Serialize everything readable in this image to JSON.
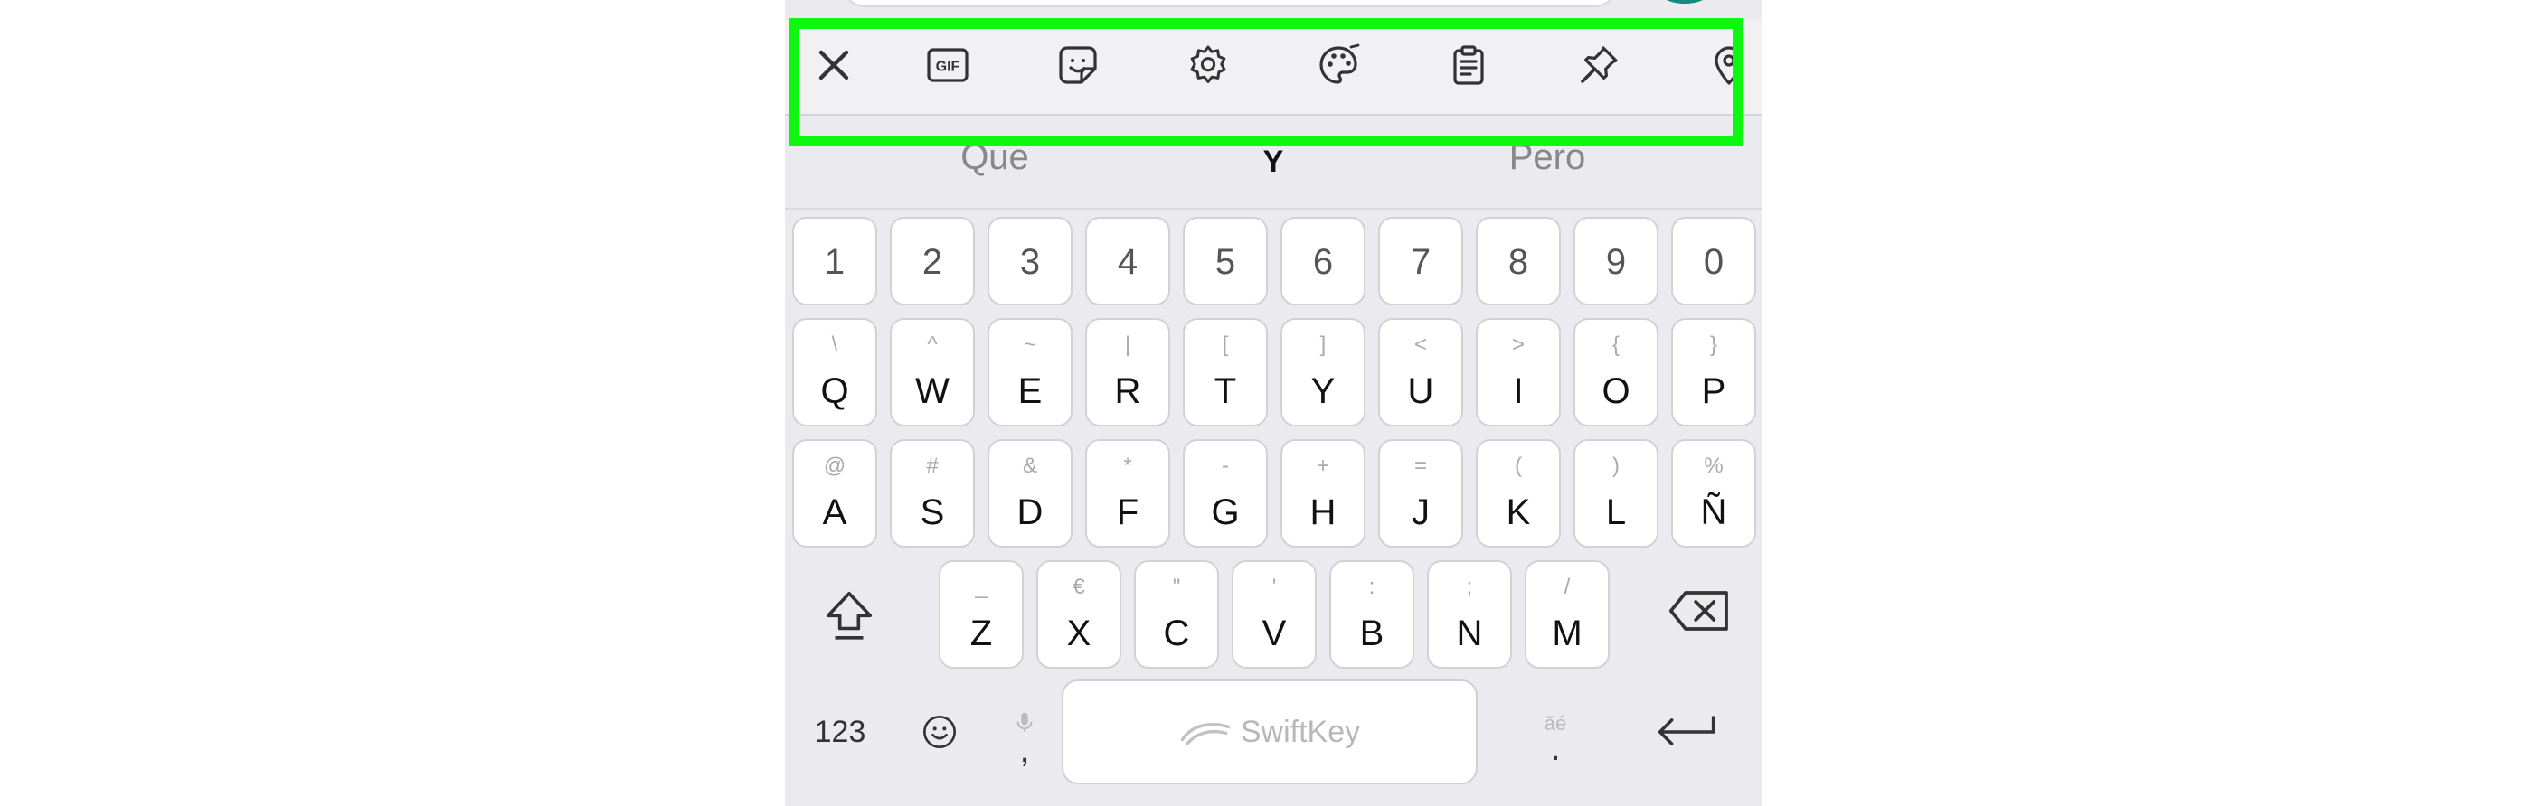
{
  "toolbar": {
    "tools": [
      {
        "icon": "close-icon"
      },
      {
        "icon": "gif-icon",
        "label": "GIF"
      },
      {
        "icon": "sticker-icon"
      },
      {
        "icon": "settings-icon"
      },
      {
        "icon": "palette-icon"
      },
      {
        "icon": "clipboard-icon"
      },
      {
        "icon": "pin-icon"
      },
      {
        "icon": "location-icon"
      }
    ]
  },
  "suggestions": {
    "left": "Que",
    "center": "Y",
    "right": "Pero"
  },
  "keyboard": {
    "number_row": [
      "1",
      "2",
      "3",
      "4",
      "5",
      "6",
      "7",
      "8",
      "9",
      "0"
    ],
    "row1": [
      {
        "main": "Q",
        "hint": "\\"
      },
      {
        "main": "W",
        "hint": "^"
      },
      {
        "main": "E",
        "hint": "~"
      },
      {
        "main": "R",
        "hint": "|"
      },
      {
        "main": "T",
        "hint": "["
      },
      {
        "main": "Y",
        "hint": "]"
      },
      {
        "main": "U",
        "hint": "<"
      },
      {
        "main": "I",
        "hint": ">"
      },
      {
        "main": "O",
        "hint": "{"
      },
      {
        "main": "P",
        "hint": "}"
      }
    ],
    "row2": [
      {
        "main": "A",
        "hint": "@"
      },
      {
        "main": "S",
        "hint": "#"
      },
      {
        "main": "D",
        "hint": "&"
      },
      {
        "main": "F",
        "hint": "*"
      },
      {
        "main": "G",
        "hint": "-"
      },
      {
        "main": "H",
        "hint": "+"
      },
      {
        "main": "J",
        "hint": "="
      },
      {
        "main": "K",
        "hint": "("
      },
      {
        "main": "L",
        "hint": ")"
      },
      {
        "main": "Ñ",
        "hint": "%"
      }
    ],
    "row3": [
      {
        "main": "Z",
        "hint": "_"
      },
      {
        "main": "X",
        "hint": "€"
      },
      {
        "main": "C",
        "hint": "\""
      },
      {
        "main": "V",
        "hint": "'"
      },
      {
        "main": "B",
        "hint": ":"
      },
      {
        "main": "N",
        "hint": ";"
      },
      {
        "main": "M",
        "hint": "/"
      }
    ],
    "bottom": {
      "numbers_label": "123",
      "comma": ",",
      "period": ".",
      "space_label": "SwiftKey"
    }
  },
  "colors": {
    "highlight": "#0ef70e",
    "keyboard_bg": "#eaeaef",
    "key_bg": "#ffffff"
  }
}
